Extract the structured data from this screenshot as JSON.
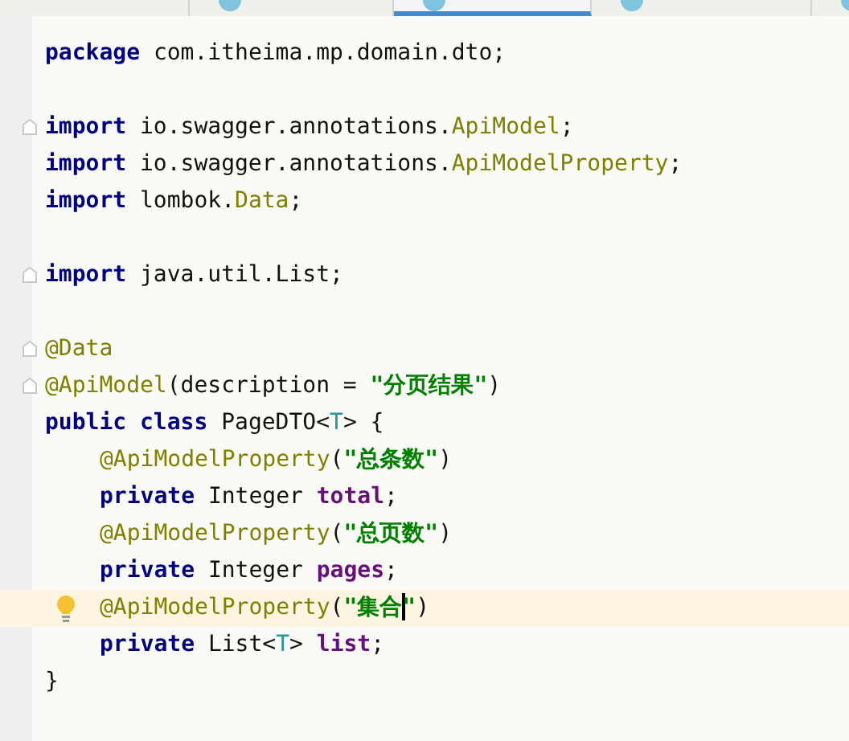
{
  "tabs": [
    {
      "selected": false
    },
    {
      "selected": false
    },
    {
      "selected": true
    },
    {
      "selected": false
    },
    {
      "selected": false
    }
  ],
  "code_lines": [
    {
      "fold": false,
      "current": false,
      "hint": false,
      "indented": false,
      "tokens": [
        {
          "kind": "keyword",
          "text": "package"
        },
        {
          "kind": "plain",
          "text": " com.itheima.mp.domain.dto;"
        }
      ]
    },
    {
      "fold": false,
      "current": false,
      "hint": false,
      "indented": false
    },
    {
      "fold": true,
      "current": false,
      "hint": false,
      "indented": false,
      "tokens": [
        {
          "kind": "keyword",
          "text": "import"
        },
        {
          "kind": "plain",
          "text": " io.swagger.annotations."
        },
        {
          "kind": "annotation",
          "text": "ApiModel"
        },
        {
          "kind": "plain",
          "text": ";"
        }
      ]
    },
    {
      "fold": false,
      "current": false,
      "hint": false,
      "indented": false,
      "tokens": [
        {
          "kind": "keyword",
          "text": "import"
        },
        {
          "kind": "plain",
          "text": " io.swagger.annotations."
        },
        {
          "kind": "annotation",
          "text": "ApiModelProperty"
        },
        {
          "kind": "plain",
          "text": ";"
        }
      ]
    },
    {
      "fold": false,
      "current": false,
      "hint": false,
      "indented": false,
      "tokens": [
        {
          "kind": "keyword",
          "text": "import"
        },
        {
          "kind": "plain",
          "text": " lombok."
        },
        {
          "kind": "annotation",
          "text": "Data"
        },
        {
          "kind": "plain",
          "text": ";"
        }
      ]
    },
    {
      "fold": false,
      "current": false,
      "hint": false,
      "indented": false
    },
    {
      "fold": true,
      "current": false,
      "hint": false,
      "indented": false,
      "tokens": [
        {
          "kind": "keyword",
          "text": "import"
        },
        {
          "kind": "plain",
          "text": " java.util.List;"
        }
      ]
    },
    {
      "fold": false,
      "current": false,
      "hint": false,
      "indented": false
    },
    {
      "fold": true,
      "current": false,
      "hint": false,
      "indented": false,
      "tokens": [
        {
          "kind": "annotation",
          "text": "@Data"
        }
      ]
    },
    {
      "fold": true,
      "current": false,
      "hint": false,
      "indented": false,
      "tokens": [
        {
          "kind": "annotation",
          "text": "@ApiModel"
        },
        {
          "kind": "plain",
          "text": "(description = "
        },
        {
          "kind": "string",
          "text": "\"分页结果\""
        },
        {
          "kind": "plain",
          "text": ")"
        }
      ]
    },
    {
      "fold": false,
      "current": false,
      "hint": false,
      "indented": false,
      "tokens": [
        {
          "kind": "keyword",
          "text": "public class"
        },
        {
          "kind": "plain",
          "text": " PageDTO<"
        },
        {
          "kind": "typeparam",
          "text": "T"
        },
        {
          "kind": "plain",
          "text": "> {"
        }
      ]
    },
    {
      "fold": false,
      "current": false,
      "hint": false,
      "indented": true,
      "tokens": [
        {
          "kind": "annotation",
          "text": "@ApiModelProperty"
        },
        {
          "kind": "plain",
          "text": "("
        },
        {
          "kind": "string",
          "text": "\"总条数\""
        },
        {
          "kind": "plain",
          "text": ")"
        }
      ]
    },
    {
      "fold": false,
      "current": false,
      "hint": false,
      "indented": true,
      "tokens": [
        {
          "kind": "keyword",
          "text": "private"
        },
        {
          "kind": "plain",
          "text": " Integer "
        },
        {
          "kind": "field",
          "text": "total"
        },
        {
          "kind": "plain",
          "text": ";"
        }
      ]
    },
    {
      "fold": false,
      "current": false,
      "hint": false,
      "indented": true,
      "tokens": [
        {
          "kind": "annotation",
          "text": "@ApiModelProperty"
        },
        {
          "kind": "plain",
          "text": "("
        },
        {
          "kind": "string",
          "text": "\"总页数\""
        },
        {
          "kind": "plain",
          "text": ")"
        }
      ]
    },
    {
      "fold": false,
      "current": false,
      "hint": false,
      "indented": true,
      "tokens": [
        {
          "kind": "keyword",
          "text": "private"
        },
        {
          "kind": "plain",
          "text": " Integer "
        },
        {
          "kind": "field",
          "text": "pages"
        },
        {
          "kind": "plain",
          "text": ";"
        }
      ]
    },
    {
      "fold": false,
      "current": true,
      "hint": true,
      "indented": true,
      "tokens": [
        {
          "kind": "annotation",
          "text": "@ApiModelProperty"
        },
        {
          "kind": "plain",
          "text": "("
        },
        {
          "kind": "string",
          "text": "\"集合",
          "caret": true
        },
        {
          "kind": "string",
          "text": "\""
        },
        {
          "kind": "plain",
          "text": ")"
        }
      ]
    },
    {
      "fold": false,
      "current": false,
      "hint": false,
      "indented": true,
      "tokens": [
        {
          "kind": "keyword",
          "text": "private"
        },
        {
          "kind": "plain",
          "text": " List<"
        },
        {
          "kind": "typeparam",
          "text": "T"
        },
        {
          "kind": "plain",
          "text": "> "
        },
        {
          "kind": "field",
          "text": "list"
        },
        {
          "kind": "plain",
          "text": ";"
        }
      ]
    },
    {
      "fold": false,
      "current": false,
      "hint": false,
      "indented": false,
      "tokens": [
        {
          "kind": "plain",
          "text": "}"
        }
      ]
    }
  ]
}
